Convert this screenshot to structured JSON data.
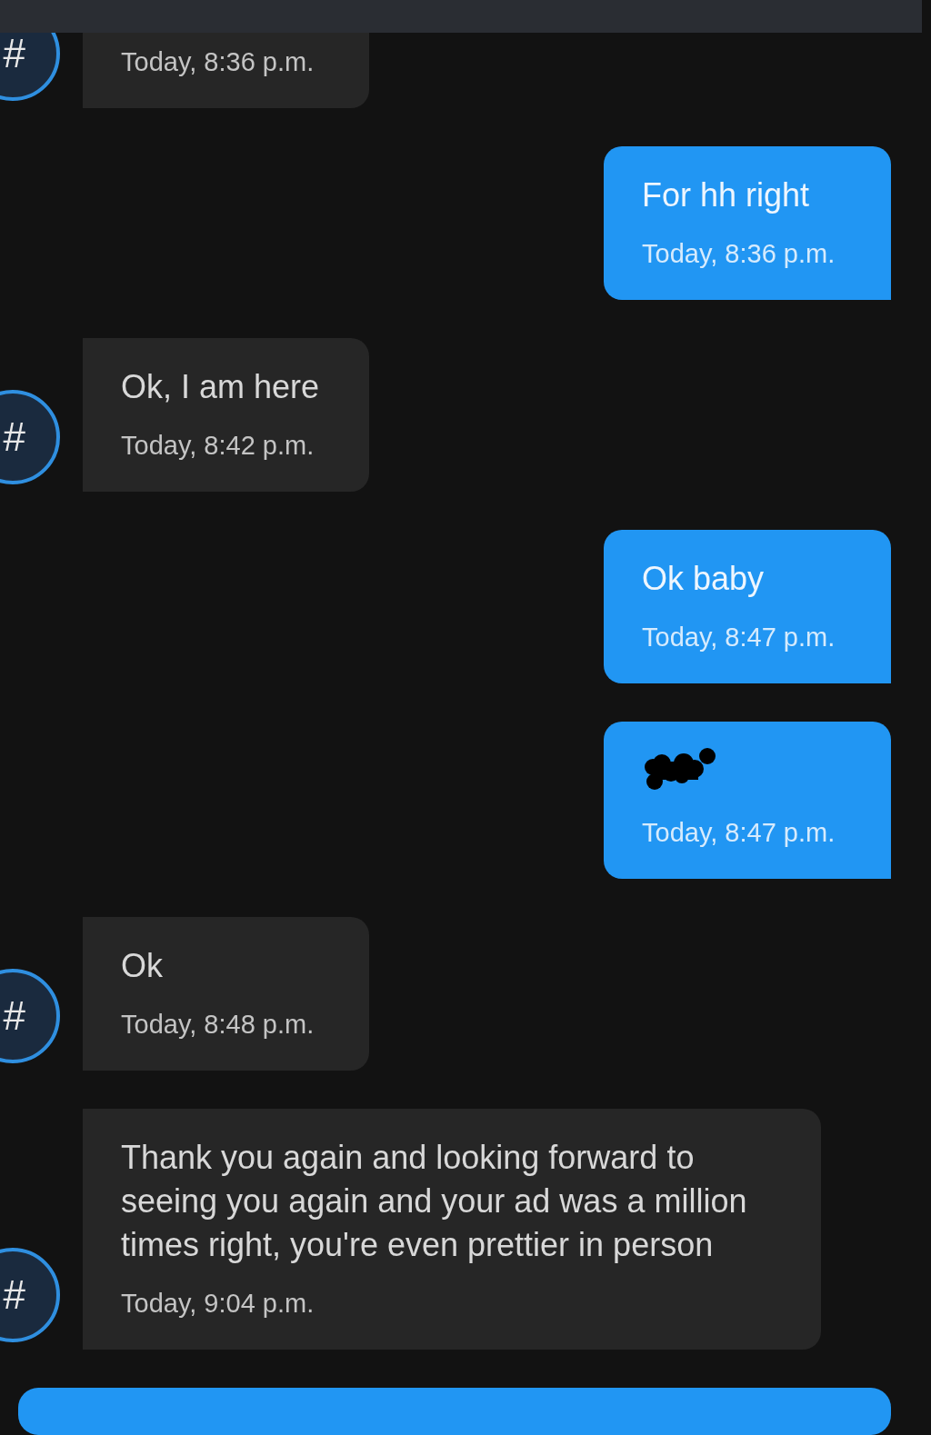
{
  "messages": [
    {
      "kind": "incoming",
      "avatar": "#",
      "time": "Today, 8:36 p.m."
    },
    {
      "kind": "outgoing",
      "text": "For hh right",
      "time": "Today, 8:36 p.m."
    },
    {
      "kind": "incoming",
      "avatar": "#",
      "text": "Ok, I am here",
      "time": "Today, 8:42 p.m."
    },
    {
      "kind": "outgoing",
      "text": "Ok baby",
      "time": "Today, 8:47 p.m."
    },
    {
      "kind": "redacted",
      "time": "Today, 8:47 p.m."
    },
    {
      "kind": "incoming",
      "avatar": "#",
      "text": "Ok",
      "time": "Today, 8:48 p.m."
    },
    {
      "kind": "incoming",
      "avatar": "#",
      "text": "Thank you again and looking forward to seeing you again and your ad was a million times right, you're even prettier in person",
      "time": "Today, 9:04 p.m."
    }
  ]
}
